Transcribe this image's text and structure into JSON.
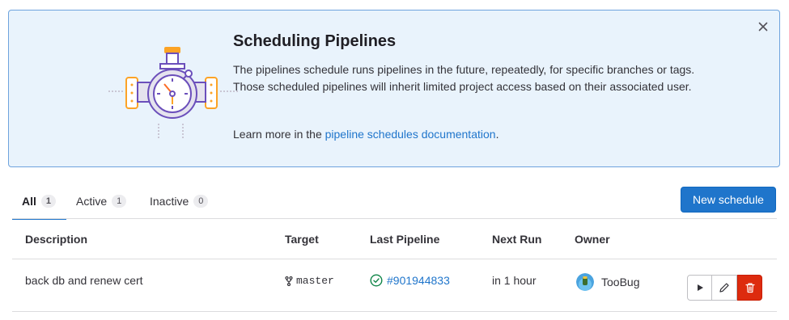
{
  "banner": {
    "title": "Scheduling Pipelines",
    "body": "The pipelines schedule runs pipelines in the future, repeatedly, for specific branches or tags. Those scheduled pipelines will inherit limited project access based on their associated user.",
    "learn_prefix": "Learn more in the ",
    "learn_link": "pipeline schedules documentation",
    "learn_suffix": ".",
    "close_icon": "close-icon",
    "illustration": "stopwatch-pipe-illustration"
  },
  "tabs": [
    {
      "label": "All",
      "count": "1",
      "active": true
    },
    {
      "label": "Active",
      "count": "1",
      "active": false
    },
    {
      "label": "Inactive",
      "count": "0",
      "active": false
    }
  ],
  "new_schedule_label": "New schedule",
  "table": {
    "columns": [
      "Description",
      "Target",
      "Last Pipeline",
      "Next Run",
      "Owner"
    ],
    "rows": [
      {
        "description": "back db and renew cert",
        "target": "master",
        "target_icon": "branch-icon",
        "last_pipeline": "#901944833",
        "pipeline_status_icon": "status-success-icon",
        "next_run": "in 1 hour",
        "owner": "TooBug",
        "actions": [
          "play-icon",
          "pencil-icon",
          "trash-icon"
        ]
      }
    ]
  },
  "colors": {
    "accent": "#1f75cb",
    "banner_bg": "#e9f3fc",
    "danger": "#dd2b0e",
    "success": "#108548"
  }
}
